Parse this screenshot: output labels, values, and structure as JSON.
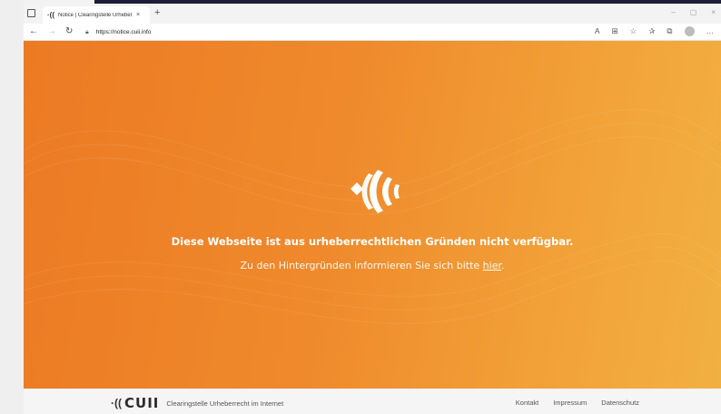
{
  "browser": {
    "tab_title": "Notice | Clearingstelle Urheberrecht",
    "tab_close": "×",
    "new_tab": "+",
    "url": "https://notice.cuii.info",
    "window_controls": [
      "–",
      "▢",
      "×"
    ]
  },
  "page": {
    "headline": "Diese Webseite ist aus urheberrechtlichen Gründen nicht verfügbar.",
    "subline_prefix": "Zu den Hintergründen informieren Sie sich bitte ",
    "subline_link": "hier",
    "subline_suffix": "."
  },
  "footer": {
    "brand": "CUII",
    "brand_sub": "Clearingstelle Urheberrecht im Internet",
    "links": [
      "Kontakt",
      "Impressum",
      "Datenschutz"
    ]
  },
  "colors": {
    "accent_start": "#ec7a24",
    "accent_end": "#f1b042"
  },
  "icons": [
    "back-arrow-icon",
    "forward-arrow-icon",
    "reload-icon",
    "lock-icon",
    "read-aloud-icon",
    "reader-icon",
    "favorite-icon",
    "favorites-icon",
    "collections-icon",
    "profile-avatar",
    "more-icon"
  ]
}
